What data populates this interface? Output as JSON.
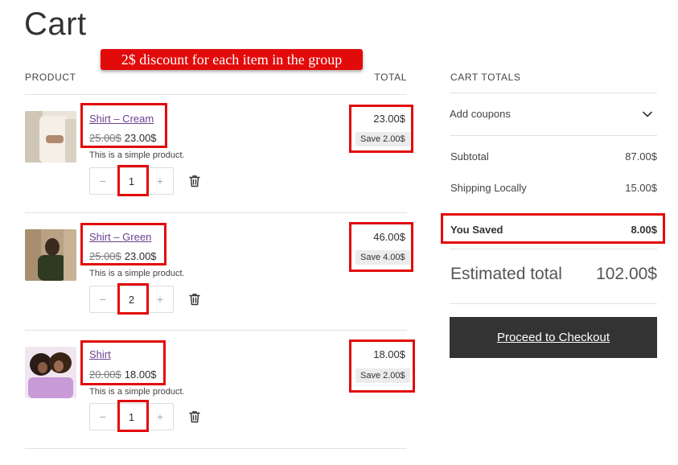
{
  "page": {
    "title": "Cart"
  },
  "annotation": {
    "text": "2$ discount for each item in the group"
  },
  "cart_table": {
    "product_header": "PRODUCT",
    "total_header": "TOTAL",
    "items": [
      {
        "name": "Shirt – Cream",
        "old_price": "25.00$",
        "new_price": "23.00$",
        "description": "This is a simple product.",
        "quantity": "1",
        "line_total": "23.00$",
        "save": "Save 2.00$"
      },
      {
        "name": "Shirt – Green",
        "old_price": "25.00$",
        "new_price": "23.00$",
        "description": "This is a simple product.",
        "quantity": "2",
        "line_total": "46.00$",
        "save": "Save 4.00$"
      },
      {
        "name": "Shirt",
        "old_price": "20.00$",
        "new_price": "18.00$",
        "description": "This is a simple product.",
        "quantity": "1",
        "line_total": "18.00$",
        "save": "Save 2.00$"
      }
    ],
    "qty_minus": "−",
    "qty_plus": "+"
  },
  "totals": {
    "header": "CART TOTALS",
    "coupons_label": "Add coupons",
    "subtotal_label": "Subtotal",
    "subtotal_value": "87.00$",
    "shipping_label": "Shipping Locally",
    "shipping_value": "15.00$",
    "saved_label": "You Saved",
    "saved_value": "8.00$",
    "estimated_label": "Estimated total",
    "estimated_value": "102.00$",
    "checkout_label": "Proceed to Checkout"
  },
  "colors": {
    "highlight": "#e20a0a",
    "link": "#6d3f8f",
    "button_bg": "#333333"
  },
  "icons": {
    "remove": "trash-icon",
    "expand": "chevron-down-icon"
  }
}
